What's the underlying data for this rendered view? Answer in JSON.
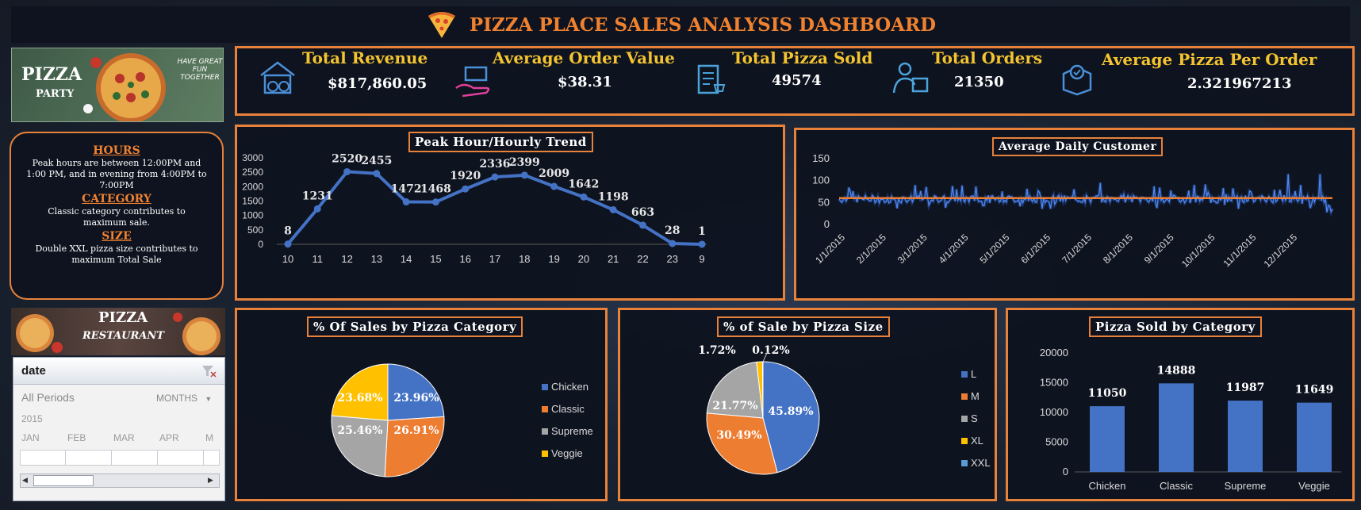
{
  "header": {
    "title": "PIZZA PLACE SALES ANALYSIS DASHBOARD",
    "icon": "pizza-slice-icon"
  },
  "kpis": [
    {
      "label": "Total Revenue",
      "value": "$817,860.05",
      "icon": "building-money-icon"
    },
    {
      "label": "Average Order Value",
      "value": "$38.31",
      "icon": "hand-box-icon"
    },
    {
      "label": "Total Pizza Sold",
      "value": "49574",
      "icon": "clipboard-cart-icon"
    },
    {
      "label": "Total Orders",
      "value": "21350",
      "icon": "delivery-person-icon"
    },
    {
      "label": "Average  Pizza Per Order",
      "value": "2.321967213",
      "icon": "box-check-icon"
    }
  ],
  "banners": {
    "top": {
      "line1": "PIZZA",
      "line2": "PARTY",
      "tagline1": "HAVE GREAT",
      "tagline2": "FUN TOGETHER"
    },
    "bottom": {
      "line1": "PIZZA",
      "line2": "RESTAURANT"
    }
  },
  "notes": {
    "hours_title": "HOURS",
    "hours_text": "Peak hours are between 12:00PM and 1:00 PM, and in evening from 4:00PM to 7:00PM",
    "category_title": "CATEGORY",
    "category_text": "Classic category contributes to maximum sale.",
    "size_title": "SIZE",
    "size_text": "Double XXL pizza size contributes to maximum Total Sale"
  },
  "slicer": {
    "field": "date",
    "all_periods": "All Periods",
    "level": "MONTHS",
    "year": "2015",
    "months": [
      "JAN",
      "FEB",
      "MAR",
      "APR",
      "M"
    ]
  },
  "colors": {
    "accent": "#e8823a",
    "kpi_label": "#f4c430",
    "blue": "#4472c4",
    "orange": "#ed7d31",
    "gray": "#a5a5a5",
    "yellow": "#ffc000"
  },
  "chart_data": [
    {
      "type": "line",
      "title": "Peak Hour/Hourly Trend",
      "categories": [
        "10",
        "11",
        "12",
        "13",
        "14",
        "15",
        "16",
        "17",
        "18",
        "19",
        "20",
        "21",
        "22",
        "23",
        "9"
      ],
      "values": [
        8,
        1231,
        2520,
        2455,
        1472,
        1468,
        1920,
        2336,
        2399,
        2009,
        1642,
        1198,
        663,
        28,
        1
      ],
      "yticks": [
        0,
        500,
        1000,
        1500,
        2000,
        2500,
        3000
      ],
      "ylim": [
        0,
        3000
      ]
    },
    {
      "type": "line",
      "title": "Average Daily Customer",
      "yticks": [
        0,
        50,
        100,
        150
      ],
      "ylim": [
        0,
        150
      ],
      "xticks": [
        "1/1/2015",
        "2/1/2015",
        "3/1/2015",
        "4/1/2015",
        "5/1/2015",
        "6/1/2015",
        "7/1/2015",
        "8/1/2015",
        "9/1/2015",
        "10/1/2015",
        "11/1/2015",
        "12/1/2015"
      ],
      "average": 60
    },
    {
      "type": "pie",
      "title": "% Of Sales by Pizza Category",
      "categories": [
        "Chicken",
        "Classic",
        "Supreme",
        "Veggie"
      ],
      "values": [
        23.96,
        26.91,
        25.46,
        23.68
      ],
      "labels": [
        "23.96%",
        "26.91%",
        "25.46%",
        "23.68%"
      ],
      "colors": [
        "#4472c4",
        "#ed7d31",
        "#a5a5a5",
        "#ffc000"
      ]
    },
    {
      "type": "pie",
      "title": "% of Sale by Pizza Size",
      "categories": [
        "L",
        "M",
        "S",
        "XL",
        "XXL"
      ],
      "values": [
        45.89,
        30.49,
        21.77,
        1.72,
        0.12
      ],
      "labels": [
        "45.89%",
        "30.49%",
        "21.77%",
        "1.72%",
        "0.12%"
      ],
      "colors": [
        "#4472c4",
        "#ed7d31",
        "#a5a5a5",
        "#ffc000",
        "#5b9bd5"
      ]
    },
    {
      "type": "bar",
      "title": "Pizza Sold by Category",
      "categories": [
        "Chicken",
        "Classic",
        "Supreme",
        "Veggie"
      ],
      "values": [
        11050,
        14888,
        11987,
        11649
      ],
      "yticks": [
        0,
        5000,
        10000,
        15000,
        20000
      ],
      "ylim": [
        0,
        20000
      ]
    }
  ]
}
